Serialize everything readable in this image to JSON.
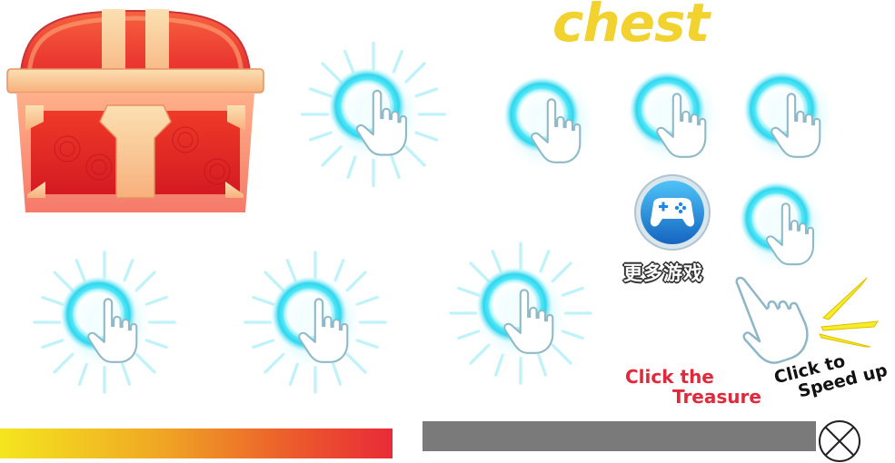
{
  "title": "chest",
  "more_games_label": "更多游戏",
  "click_treasure": {
    "line1": "Click the",
    "line2": "Treasure"
  },
  "click_speed": {
    "line1": "Click to",
    "line2": "Speed up"
  },
  "icons": {
    "chest": "treasure-chest-icon",
    "tap": "tap-hand-icon",
    "gamepad": "gamepad-icon",
    "pointer": "pointing-hand-icon",
    "close": "close-icon"
  },
  "colors": {
    "title": "#f2d22e",
    "glow": "#3fe6f5",
    "click_treasure": "#e02a3c",
    "bar_start": "#f4e61e",
    "bar_end": "#e82a38",
    "bar_gray": "#7a7a7a",
    "gamepad_bg": "#1c8fe0"
  }
}
